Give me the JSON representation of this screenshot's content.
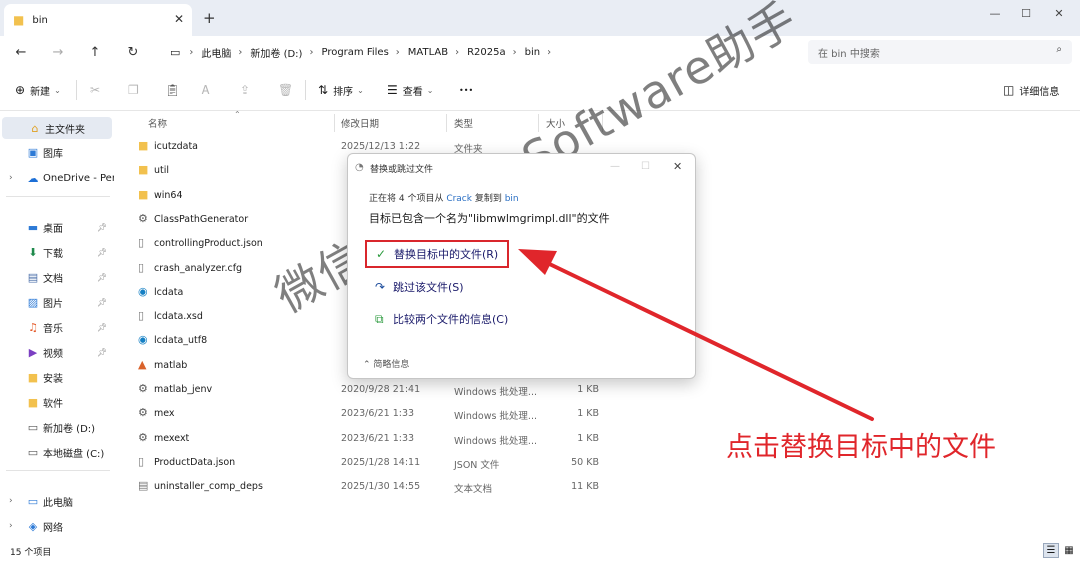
{
  "tab": {
    "title": "bin",
    "close": "✕",
    "new": "+"
  },
  "window_controls": {
    "minimize": "—",
    "maximize": "☐",
    "close": "✕"
  },
  "breadcrumb": [
    "此电脑",
    "新加卷 (D:)",
    "Program Files",
    "MATLAB",
    "R2025a",
    "bin"
  ],
  "search": {
    "placeholder": "在 bin 中搜索"
  },
  "toolbar": {
    "new": "新建",
    "sort": "排序",
    "view": "查看",
    "more": "•••",
    "details": "详细信息"
  },
  "nav": {
    "items": [
      {
        "label": "主文件夹",
        "icon": "home-icon",
        "glyph": "⌂",
        "color": "#e0a020",
        "selected": true
      },
      {
        "label": "图库",
        "icon": "gallery-icon",
        "glyph": "▣",
        "color": "#2d7ad6"
      },
      {
        "label": "OneDrive - Per",
        "icon": "cloud-icon",
        "glyph": "☁",
        "color": "#1c6fd6",
        "expand": true
      },
      {
        "label": "桌面",
        "icon": "desktop-icon",
        "glyph": "▬",
        "color": "#2d7ad6",
        "pinned": true
      },
      {
        "label": "下载",
        "icon": "download-icon",
        "glyph": "⬇",
        "color": "#1f8a4c",
        "pinned": true
      },
      {
        "label": "文档",
        "icon": "document-icon",
        "glyph": "▤",
        "color": "#4a6ea8",
        "pinned": true
      },
      {
        "label": "图片",
        "icon": "picture-icon",
        "glyph": "▨",
        "color": "#2d7ad6",
        "pinned": true
      },
      {
        "label": "音乐",
        "icon": "music-icon",
        "glyph": "♫",
        "color": "#e45a2a",
        "pinned": true
      },
      {
        "label": "视频",
        "icon": "video-icon",
        "glyph": "▶",
        "color": "#7b3fc2",
        "pinned": true
      },
      {
        "label": "安装",
        "icon": "folder-icon",
        "glyph": "■",
        "color": "#f2c14e"
      },
      {
        "label": "软件",
        "icon": "folder-icon",
        "glyph": "■",
        "color": "#f2c14e"
      },
      {
        "label": "新加卷 (D:)",
        "icon": "drive-icon",
        "glyph": "▭",
        "color": "#555555"
      },
      {
        "label": "本地磁盘 (C:)",
        "icon": "drive-icon",
        "glyph": "▭",
        "color": "#555555"
      },
      {
        "label": "此电脑",
        "icon": "computer-icon",
        "glyph": "▭",
        "color": "#2d7ad6",
        "expand": true
      },
      {
        "label": "网络",
        "icon": "network-icon",
        "glyph": "◈",
        "color": "#2d7ad6",
        "expand": true
      }
    ]
  },
  "columns": [
    "名称",
    "修改日期",
    "类型",
    "大小"
  ],
  "files": [
    {
      "name": "icutzdata",
      "date": "2025/12/13 1:22",
      "type": "文件夹",
      "size": "",
      "icon": "folder-icon",
      "glyph": "■",
      "color": "#f2c14e"
    },
    {
      "name": "util",
      "date": "",
      "type": "",
      "size": "",
      "icon": "folder-icon",
      "glyph": "■",
      "color": "#f2c14e"
    },
    {
      "name": "win64",
      "date": "",
      "type": "",
      "size": "",
      "icon": "folder-icon",
      "glyph": "■",
      "color": "#f2c14e"
    },
    {
      "name": "ClassPathGenerator",
      "date": "",
      "type": "",
      "size": "",
      "icon": "batch-file-icon",
      "glyph": "⚙",
      "color": "#555555"
    },
    {
      "name": "controllingProduct.json",
      "date": "",
      "type": "",
      "size": "",
      "icon": "file-icon",
      "glyph": "▯",
      "color": "#777777"
    },
    {
      "name": "crash_analyzer.cfg",
      "date": "",
      "type": "",
      "size": "",
      "icon": "file-icon",
      "glyph": "▯",
      "color": "#777777"
    },
    {
      "name": "lcdata",
      "date": "",
      "type": "",
      "size": "",
      "icon": "edge-icon",
      "glyph": "◉",
      "color": "#1580c4"
    },
    {
      "name": "lcdata.xsd",
      "date": "",
      "type": "",
      "size": "",
      "icon": "file-icon",
      "glyph": "▯",
      "color": "#777777"
    },
    {
      "name": "lcdata_utf8",
      "date": "",
      "type": "",
      "size": "",
      "icon": "edge-icon",
      "glyph": "◉",
      "color": "#1580c4"
    },
    {
      "name": "matlab",
      "date": "",
      "type": "",
      "size": "",
      "icon": "matlab-icon",
      "glyph": "▲",
      "color": "#d9622b"
    },
    {
      "name": "matlab_jenv",
      "date": "2020/9/28 21:41",
      "type": "Windows 批处理...",
      "size": "1 KB",
      "icon": "batch-file-icon",
      "glyph": "⚙",
      "color": "#555555"
    },
    {
      "name": "mex",
      "date": "2023/6/21 1:33",
      "type": "Windows 批处理...",
      "size": "1 KB",
      "icon": "batch-file-icon",
      "glyph": "⚙",
      "color": "#555555"
    },
    {
      "name": "mexext",
      "date": "2023/6/21 1:33",
      "type": "Windows 批处理...",
      "size": "1 KB",
      "icon": "batch-file-icon",
      "glyph": "⚙",
      "color": "#555555"
    },
    {
      "name": "ProductData.json",
      "date": "2025/1/28 14:11",
      "type": "JSON 文件",
      "size": "50 KB",
      "icon": "file-icon",
      "glyph": "▯",
      "color": "#777777"
    },
    {
      "name": "uninstaller_comp_deps",
      "date": "2025/1/30 14:55",
      "type": "文本文档",
      "size": "11 KB",
      "icon": "text-file-icon",
      "glyph": "▤",
      "color": "#777777"
    }
  ],
  "status": {
    "count": "15 个项目"
  },
  "dialog": {
    "title": "替换或跳过文件",
    "line1_a": "正在将 4 个项目从 ",
    "line1_src": "Crack",
    "line1_b": " 复制到 ",
    "line1_dst": "bin",
    "line2": "目标已包含一个名为\"libmwlmgrimpl.dll\"的文件",
    "option_replace": "替换目标中的文件(R)",
    "option_skip": "跳过该文件(S)",
    "option_compare": "比较两个文件的信息(C)",
    "more": "简略信息"
  },
  "watermark": "微信公众号：Software助手",
  "annotation": {
    "text": "点击替换目标中的文件",
    "color": "#e0262b"
  }
}
